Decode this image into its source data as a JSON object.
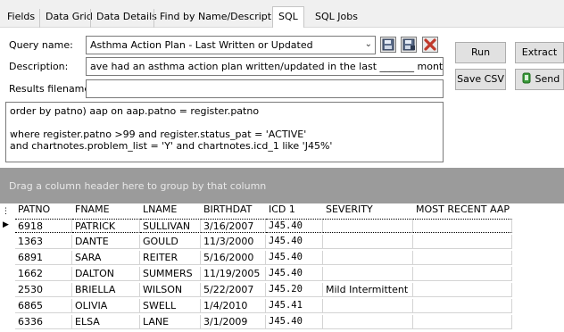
{
  "tabs": [
    {
      "label": "Fields"
    },
    {
      "label": "Data Grid"
    },
    {
      "label": "Data Details"
    },
    {
      "label": "Find by Name/Description"
    },
    {
      "label": "SQL"
    },
    {
      "label": "SQL Jobs"
    }
  ],
  "form": {
    "query_name_label": "Query name:",
    "query_name_value": "Asthma Action Plan - Last Written or Updated",
    "description_label": "Description:",
    "description_value": "ave had an asthma action plan written/updated in the last _______ months/years?",
    "results_filename_label": "Results filename:",
    "results_filename_value": ""
  },
  "buttons": {
    "run": "Run",
    "extract": "Extract",
    "save_csv": "Save CSV",
    "send": "Send"
  },
  "sql_lines": [
    "order by patno) aap on aap.patno = register.patno",
    "",
    "where register.patno >99 and register.status_pat = 'ACTIVE'",
    "and chartnotes.problem_list = 'Y' and chartnotes.icd_1 like 'J45%'"
  ],
  "group_panel_text": "Drag a column header here to group by that column",
  "grid": {
    "columns": [
      "PATNO",
      "FNAME",
      "LNAME",
      "BIRTHDAT",
      "ICD 1",
      "SEVERITY",
      "MOST RECENT AAP"
    ],
    "rows": [
      [
        "6918",
        "PATRICK",
        "SULLIVAN",
        "3/16/2007",
        "J45.40",
        "",
        ""
      ],
      [
        "1363",
        "DANTE",
        "GOULD",
        "11/3/2000",
        "J45.40",
        "",
        ""
      ],
      [
        "6891",
        "SARA",
        "REITER",
        "5/16/2000",
        "J45.40",
        "",
        ""
      ],
      [
        "1662",
        "DALTON",
        "SUMMERS",
        "11/19/2005",
        "J45.40",
        "",
        ""
      ],
      [
        "2530",
        "BRIELLA",
        "WILSON",
        "5/22/2007",
        "J45.20",
        "Mild Intermittent",
        ""
      ],
      [
        "6865",
        "OLIVIA",
        "SWELL",
        "1/4/2010",
        "J45.41",
        "",
        ""
      ],
      [
        "6336",
        "ELSA",
        "LANE",
        "3/1/2009",
        "J45.40",
        "",
        ""
      ]
    ]
  },
  "colors": {
    "group_panel_bg": "#9b9b9b",
    "tabbar_bg": "#f0f0f0",
    "delete_icon": "#c0392b",
    "send_icon": "#3a9a3a"
  }
}
